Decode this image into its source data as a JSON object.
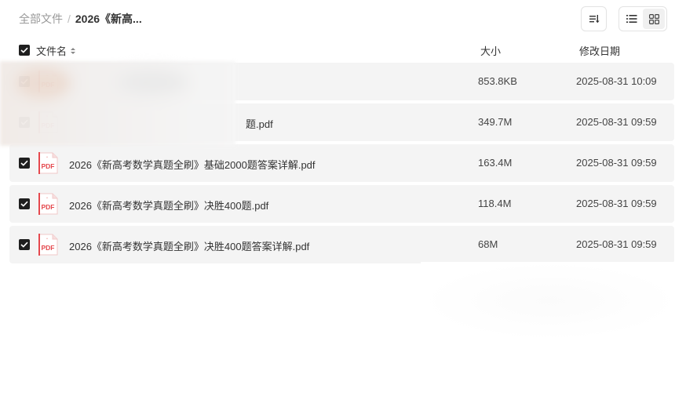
{
  "breadcrumb": {
    "root": "全部文件",
    "separator": "/",
    "current": "2026《新高..."
  },
  "toolbar": {
    "sort_icon": "sort-list-icon",
    "list_view_icon": "list-view-icon",
    "grid_view_icon": "grid-view-icon",
    "active_view": "list"
  },
  "header": {
    "name": "文件名",
    "size": "大小",
    "date": "修改日期",
    "select_all_checked": true
  },
  "files": [
    {
      "name": "",
      "size": "853.8KB",
      "date": "2025-08-31 10:09",
      "checked": true,
      "type": "pdf"
    },
    {
      "name": "题.pdf",
      "size": "349.7M",
      "date": "2025-08-31 09:59",
      "checked": true,
      "type": "pdf"
    },
    {
      "name": "2026《新高考数学真题全刷》基础2000题答案详解.pdf",
      "size": "163.4M",
      "date": "2025-08-31 09:59",
      "checked": true,
      "type": "pdf"
    },
    {
      "name": "2026《新高考数学真题全刷》决胜400题.pdf",
      "size": "118.4M",
      "date": "2025-08-31 09:59",
      "checked": true,
      "type": "pdf"
    },
    {
      "name": "2026《新高考数学真题全刷》决胜400题答案详解.pdf",
      "size": "68M",
      "date": "2025-08-31 09:59",
      "checked": true,
      "type": "pdf"
    }
  ],
  "pdf_icon_label": "PDF",
  "colors": {
    "row_bg": "#f4f4f4",
    "checkbox": "#1f1f1f",
    "pdf_red": "#e5484d"
  }
}
